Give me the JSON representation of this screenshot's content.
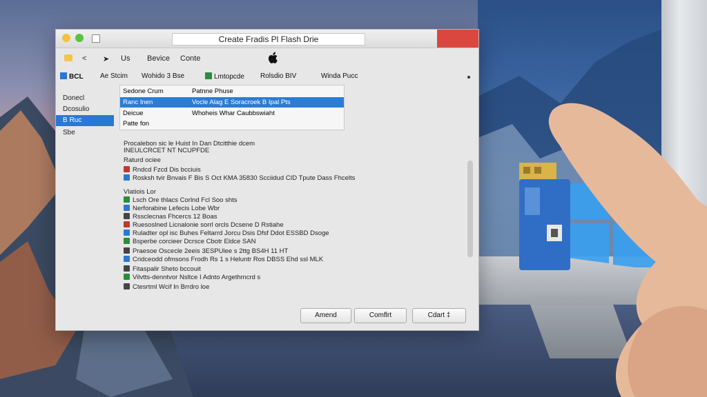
{
  "window": {
    "title": "Create Fradis Pl Flash Drie",
    "close_color": "#d9473f"
  },
  "toolbar": {
    "back": "<",
    "forward": "➤",
    "us": "Us",
    "device": "Bevice",
    "create": "Conte"
  },
  "tabs": [
    {
      "label": "BCL"
    },
    {
      "label": "Ae Stcim"
    },
    {
      "label": "Wohido 3 Bse"
    },
    {
      "label": "Lmtopcde"
    },
    {
      "label": "Rolsdio BIV"
    },
    {
      "label": "Winda Pucc"
    }
  ],
  "sidebar": {
    "items": [
      "Donecl",
      "Dcosulio",
      "B Ruc",
      "Sbe"
    ],
    "selected_index": 2
  },
  "dropdown": {
    "header_a": "Sedone Crum",
    "header_b": "Patnne Phuse",
    "rows": [
      {
        "a": "Ranc Inen",
        "b": "Vocle Alag E Soracroek B Ipal Pts"
      },
      {
        "a": "Deicue",
        "b": "Whoheis Whar Caubbswiaht"
      },
      {
        "a": "Patte fon",
        "b": ""
      }
    ]
  },
  "content": {
    "lines": [
      {
        "icon": "",
        "text": "Procalebon sic le Huist In Dan Dtcitthie dcem"
      },
      {
        "icon": "",
        "text": "INEULCRCET NT NCUPFDE"
      },
      {
        "icon": "",
        "text": "Raturd ociee"
      },
      {
        "icon": "doc-icon",
        "text": "Rndcd Fzcd Dis bcciuis"
      },
      {
        "icon": "doc-icon",
        "text": "Rosksh tvir Bnvais F Bis S Oct KMA 35830 Scciidud CID Tpute Dass Fhcelts"
      },
      {
        "icon": "",
        "text": "Vlatiois Lor"
      },
      {
        "icon": "doc-icon",
        "text": "Lsch Ore thlacs Corlnd Fcl Soo shts"
      },
      {
        "icon": "doc-icon",
        "text": "Nerforabine Lefecis Lobe Wbr"
      },
      {
        "icon": "doc-icon",
        "text": "Rssclecnas Fhcercs 12 Boas"
      },
      {
        "icon": "doc-icon",
        "text": "Ruesoslned Licnalonie sorrl orcls Dcsene D Rstiahe"
      },
      {
        "icon": "doc-icon",
        "text": "Ruladter opl isc Buhes Feltarrd Jorcu Dsis Dfsf Ddot ESSBD Dsoge"
      },
      {
        "icon": "doc-icon",
        "text": "Bsperbe corcieer Dcrsce Cbotr Eldce SAN"
      },
      {
        "icon": "doc-icon",
        "text": "Praesoe Oscecle 2eeis 3ESPUlee s 2ttg BS4H 11 HT"
      },
      {
        "icon": "doc-icon",
        "text": "Cridceodd ofmsons Frodh Rs 1 s Heluntr Ros DBSS Ehd ssl MLK"
      },
      {
        "icon": "doc-icon",
        "text": "Fitaspalir Sheto bccouit"
      },
      {
        "icon": "doc-icon",
        "text": "Vilvtts-denntvor Nsltce I Adnto Argethmcrd s"
      },
      {
        "icon": "doc-icon",
        "text": "Ctesrtml Wcif In Brrdro loe"
      }
    ]
  },
  "buttons": {
    "amend": "Amend",
    "confirm": "Comflrt",
    "cancel": "Cdart ‡"
  },
  "colors": {
    "accent": "#2b78d4",
    "usb_blue": "#2f6ec4",
    "gold": "#d8b449"
  }
}
